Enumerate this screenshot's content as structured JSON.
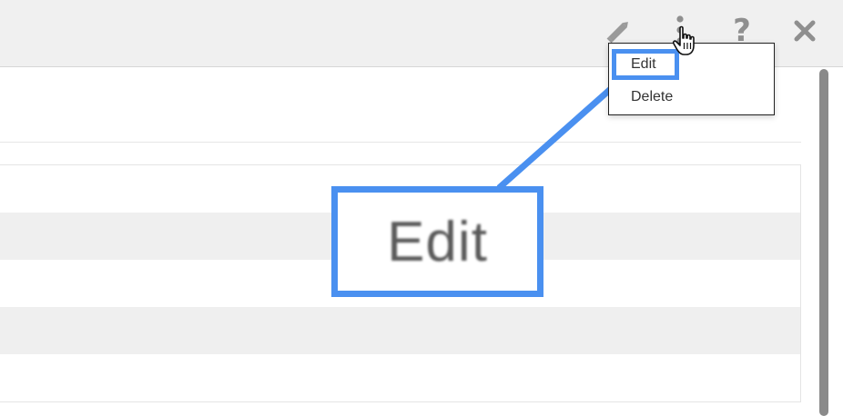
{
  "menu": {
    "edit_label": "Edit",
    "delete_label": "Delete"
  },
  "callout": {
    "label": "Edit"
  },
  "icons": {
    "edit": "pencil-icon",
    "more": "more-vertical-icon",
    "help": "help-icon",
    "close": "close-icon",
    "cursor": "hand-pointer-icon"
  },
  "colors": {
    "highlight": "#4a90f0",
    "toolbar_bg": "#f0f0f0",
    "icon": "#8f8f8f",
    "row_alt": "#efefef"
  }
}
